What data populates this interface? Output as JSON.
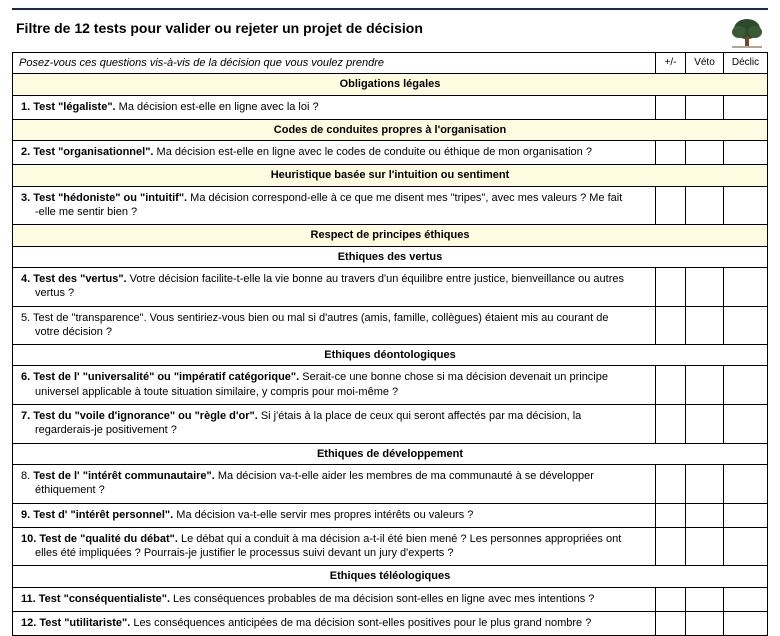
{
  "title": "Filtre de 12 tests pour valider ou rejeter un projet de décision",
  "instruction": "Posez-vous ces questions vis-à-vis de la décision que vous voulez prendre",
  "cols": {
    "pm": "+/-",
    "veto": "Véto",
    "declic": "Déclic"
  },
  "sections": [
    {
      "section": "Obligations légales",
      "rows": [
        {
          "b": "1. Test \"légaliste\".",
          "t": " Ma décision est-elle en ligne avec la loi ?"
        }
      ]
    },
    {
      "section": "Codes de conduites propres à l'organisation",
      "rows": [
        {
          "b": "2. Test \"organisationnel\".",
          "t": " Ma décision est-elle en ligne avec le codes de conduite ou éthique de mon organisation ?"
        }
      ]
    },
    {
      "section": "Heuristique basée sur l'intuition ou sentiment",
      "rows": [
        {
          "b": "3. Test \"hédoniste\" ou \"intuitif\".",
          "t": " Ma décision correspond-elle à ce que me disent mes \"tripes\", avec mes valeurs ? Me fait",
          "t2": "-elle me sentir bien ?"
        }
      ]
    },
    {
      "section": "Respect de principes éthiques",
      "subs": [
        {
          "sub": "Ethiques des vertus",
          "rows": [
            {
              "b": "4. Test des \"vertus\".",
              "t": "  Votre décision facilite-t-elle la vie bonne au travers d'un équilibre entre justice, bienveillance ou autres",
              "t2": "vertus ?"
            },
            {
              "b": "",
              "t": "5. Test de \"transparence\".  Vous sentiriez-vous bien ou mal si d'autres (amis, famille, collègues) étaient mis au courant de",
              "t2": "votre décision ?"
            }
          ]
        },
        {
          "sub": "Ethiques déontologiques",
          "rows": [
            {
              "b": "6. Test de l' \"universalité\" ou \"impératif catégorique\".",
              "t": "  Serait-ce une bonne chose si ma décision devenait un principe",
              "t2": "universel applicable à toute situation similaire, y compris pour moi-même ?"
            },
            {
              "b": "7. Test du \"voile d'ignorance\" ou \"règle d'or\".",
              "t": " Si j'étais à la place de ceux qui seront affectés par ma décision, la",
              "t2": "regarderais-je positivement ?"
            }
          ]
        },
        {
          "sub": "Ethiques de développement",
          "rows": [
            {
              "pre": "8.",
              "b": " Test de l' \"intérêt communautaire\".",
              "t": "  Ma décision va-t-elle aider les membres de ma communauté à se développer",
              "t2": "éthiquement ?"
            },
            {
              "b": "9. Test d' \"intérêt personnel\".",
              "t": "  Ma décision va-t-elle servir mes propres intérêts ou valeurs ?"
            },
            {
              "b": "10. Test de \"qualité du débat\".",
              "t": " Le débat qui a conduit à ma décision a-t-il été bien mené ? Les personnes appropriées ont",
              "t2": "elles été impliquées ? Pourrais-je justifier le processus suivi devant un jury d'experts ?"
            }
          ]
        },
        {
          "sub": "Ethiques téléologiques",
          "rows": [
            {
              "b": "11. Test \"conséquentialiste\".",
              "t": "  Les conséquences probables de ma décision sont-elles en ligne avec mes intentions ?"
            },
            {
              "b": "12. Test \"utilitariste\".",
              "t": "  Les conséquences anticipées de ma décision sont-elles positives pour le plus grand nombre ?"
            }
          ]
        }
      ]
    }
  ]
}
